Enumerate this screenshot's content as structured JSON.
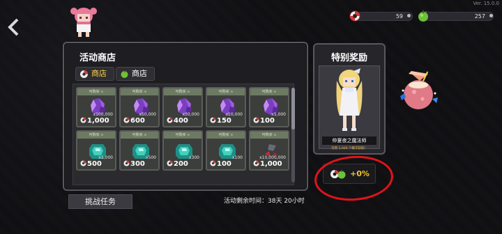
{
  "version": "Ver. 15.0.0",
  "resources": [
    {
      "name": "float-ring",
      "value": "59"
    },
    {
      "name": "green-fruit",
      "value": "257"
    }
  ],
  "shop": {
    "title": "活动商店",
    "tabs": [
      {
        "label": "商店",
        "icon": "float-ring-icon",
        "active": true
      },
      {
        "label": "商店",
        "icon": "green-fruit-icon",
        "active": false
      }
    ],
    "items": [
      {
        "header": "可购买 ∞",
        "item": "purple-crystal",
        "qty": "x100,000",
        "price": "1,000"
      },
      {
        "header": "可购买 ∞",
        "item": "purple-crystal",
        "qty": "x50,000",
        "price": "600"
      },
      {
        "header": "可购买 ∞",
        "item": "purple-crystal",
        "qty": "x30,000",
        "price": "400"
      },
      {
        "header": "可购买 ∞",
        "item": "purple-crystal",
        "qty": "x10,000",
        "price": "150"
      },
      {
        "header": "可购买 ∞",
        "item": "purple-crystal",
        "qty": "x5,000",
        "price": "100"
      },
      {
        "header": "可购买 ∞",
        "item": "teal-gem",
        "qty": "x1,000",
        "price": "500"
      },
      {
        "header": "可购买 ∞",
        "item": "teal-gem",
        "qty": "x500",
        "price": "300"
      },
      {
        "header": "可购买 ∞",
        "item": "teal-gem",
        "qty": "x300",
        "price": "200"
      },
      {
        "header": "可购买 ∞",
        "item": "teal-gem",
        "qty": "x100",
        "price": "100"
      },
      {
        "header": "可购买 ∞",
        "item": "dark-ore",
        "qty": "x10,000,000",
        "price": "1,000"
      }
    ]
  },
  "special": {
    "title": "特别奖励",
    "name": "仲夏夜之魔法师",
    "note": "可用 5,000 个椰子获取！",
    "bonus": "+0%"
  },
  "challenge_button": "挑战任务",
  "timer": "活动剩余时间：38天 20小时",
  "colors": {
    "accent": "#f2c232",
    "highlight_circle": "#e0141a",
    "tab_active": "#ffd84a"
  }
}
